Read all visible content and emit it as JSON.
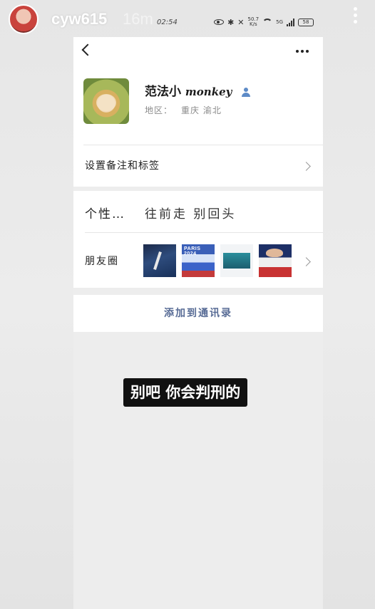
{
  "story": {
    "username": "cyw615",
    "age": "16m"
  },
  "phone_status": {
    "time": "02:54",
    "net_speed_value": "50.7",
    "net_speed_unit": "K/s",
    "network": "5G",
    "battery": "58"
  },
  "profile": {
    "name_cjk": "范法小",
    "name_latin": "monkey",
    "region_label": "地区：",
    "region_value": "重庆  渝北",
    "remark_label": "设置备注和标签"
  },
  "info": {
    "signature_label": "个性…",
    "signature_value": "往前走 别回头",
    "moments_label": "朋友圈",
    "thumb2_text": "PARIS 2024"
  },
  "actions": {
    "add_contact": "添加到通讯录"
  },
  "caption": "别吧 你会判刑的"
}
